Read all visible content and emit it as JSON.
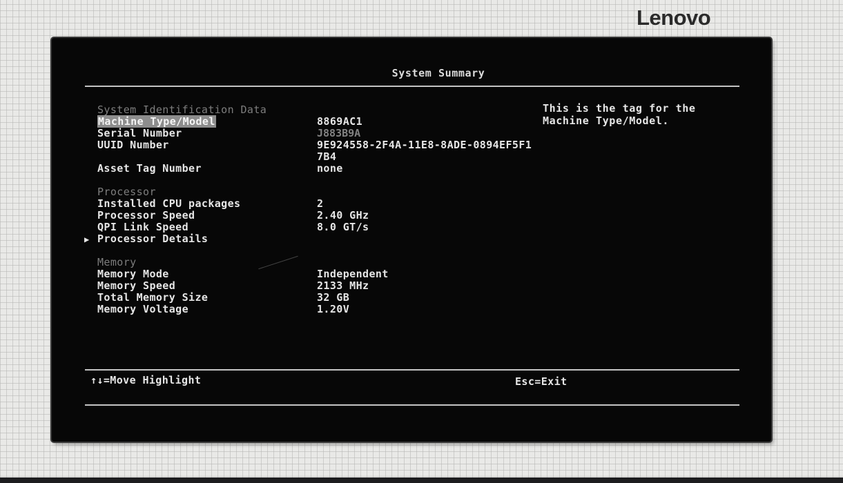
{
  "brand": {
    "logo_text": "Lenovo"
  },
  "screen": {
    "title": "System Summary",
    "sections": {
      "system_identification": {
        "heading": "System Identification Data",
        "rows": [
          {
            "label": "Machine Type/Model",
            "value": "8869AC1"
          },
          {
            "label": "Serial Number",
            "value": "J883B9A"
          },
          {
            "label": "UUID Number",
            "value": "9E924558-2F4A-11E8-8ADE-0894EF5F1",
            "value2": "7B4"
          },
          {
            "label": "Asset Tag Number",
            "value": "none"
          }
        ]
      },
      "processor": {
        "heading": "Processor",
        "rows": [
          {
            "label": "Installed CPU packages",
            "value": "2"
          },
          {
            "label": "Processor Speed",
            "value": "2.40 GHz"
          },
          {
            "label": "QPI Link Speed",
            "value": "8.0 GT/s"
          },
          {
            "label": "Processor Details"
          }
        ]
      },
      "memory": {
        "heading": "Memory",
        "rows": [
          {
            "label": "Memory Mode",
            "value": "Independent"
          },
          {
            "label": "Memory Speed",
            "value": "2133 MHz"
          },
          {
            "label": "Total Memory Size",
            "value": "32 GB"
          },
          {
            "label": "Memory Voltage",
            "value": "1.20V"
          }
        ]
      }
    },
    "help": {
      "line1": "This is the tag for the",
      "line2": "Machine Type/Model."
    },
    "footer": {
      "left": "↑↓=Move Highlight",
      "right": "Esc=Exit"
    }
  },
  "colors": {
    "screen_bg": "#070707",
    "text": "#e6e6e6",
    "section_heading": "#7d7d7d",
    "highlight_bg": "#8d8d8d"
  },
  "icons": {
    "submenu_pointer": "triangle-right-icon"
  }
}
